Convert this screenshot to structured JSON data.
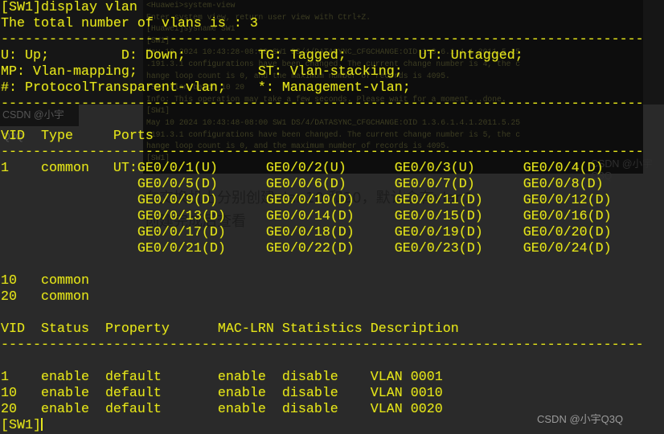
{
  "terminal": {
    "lines": [
      "[SW1]display vlan",
      "The total number of vlans is : 3",
      "--------------------------------------------------------------------------------",
      "U: Up;         D: Down;         TG: Tagged;         UT: Untagged;",
      "MP: Vlan-mapping;               ST: Vlan-stacking;",
      "#: ProtocolTransparent-vlan;    *: Management-vlan;",
      "--------------------------------------------------------------------------------",
      "",
      "VID  Type     Ports",
      "--------------------------------------------------------------------------------",
      "1    common   UT:GE0/0/1(U)      GE0/0/2(U)      GE0/0/3(U)      GE0/0/4(D)",
      "                 GE0/0/5(D)      GE0/0/6(D)      GE0/0/7(D)      GE0/0/8(D)",
      "                 GE0/0/9(D)      GE0/0/10(D)     GE0/0/11(D)     GE0/0/12(D)",
      "                 GE0/0/13(D)     GE0/0/14(D)     GE0/0/15(D)     GE0/0/16(D)",
      "                 GE0/0/17(D)     GE0/0/18(D)     GE0/0/19(D)     GE0/0/20(D)",
      "                 GE0/0/21(D)     GE0/0/22(D)     GE0/0/23(D)     GE0/0/24(D)",
      "",
      "10   common",
      "20   common",
      "",
      "VID  Status  Property      MAC-LRN Statistics Description",
      "--------------------------------------------------------------------------------",
      "",
      "1    enable  default       enable  disable    VLAN 0001",
      "10   enable  default       enable  disable    VLAN 0010",
      "20   enable  default       enable  disable    VLAN 0020",
      "[SW1]"
    ]
  },
  "background_console": {
    "lines": [
      "<Huawei>system-view",
      "Enter system view, return user view with Ctrl+Z.",
      "[Huawei]sysname SW1",
      "[SW1]",
      "May 10 2024 10:43:28-08:00 SW1 DS/4/DATASYNC_CFGCHANGE:OID 1.3.6.1.4.1.2011.5.25",
      ".191.3.1 configurations have been changed. The current change number is 4, the c",
      "hange loop count is 0, and the maximum number of records is 4095.",
      "[SW1]vlan batch 10 20",
      "Info: This operation may take a few seconds. Please wait for a moment...done.",
      "[SW1]",
      "May 10 2024 10:43:48-08:00 SW1 DS/4/DATASYNC_CFGCHANGE:OID 1.3.6.1.4.1.2011.5.25",
      ".191.3.1 configurations have been changed. The current change number is 5, the c",
      "hange loop count is 0, and the maximum number of records is 4095.",
      "[SW1]"
    ]
  },
  "caption": {
    "line1": "在交换机上分别创建vlan10 和20，默认会有vlan1",
    "line2": "创建完成后查看"
  },
  "watermark": "CSDN @小宇Q3Q",
  "colors": {
    "terminal_text": "#e4e41e",
    "background": "#2a2a2a"
  }
}
